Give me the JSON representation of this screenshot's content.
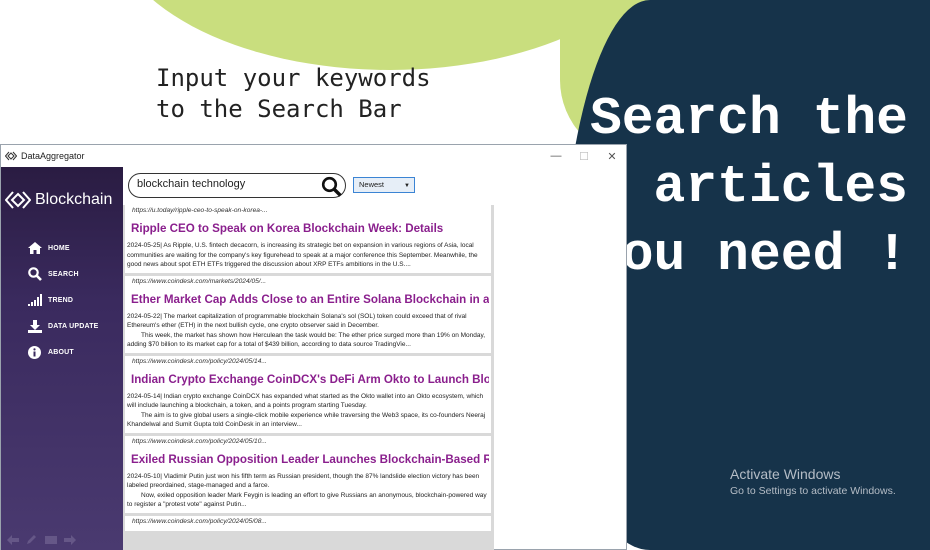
{
  "caption": "Input your keywords\nto the Search Bar",
  "headline": "Search the articles you need !",
  "activation": {
    "line1": "Activate Windows",
    "line2": "Go to Settings to activate Windows."
  },
  "window": {
    "title": "DataAggregator",
    "controls": {
      "minimize": "—",
      "maximize": "☐",
      "close": "✕"
    }
  },
  "sidebar": {
    "brand": "Blockchain",
    "items": [
      {
        "label": "HOME",
        "icon": "home-icon"
      },
      {
        "label": "SEARCH",
        "icon": "search-icon"
      },
      {
        "label": "TREND",
        "icon": "signal-bars-icon"
      },
      {
        "label": "DATA UPDATE",
        "icon": "download-icon"
      },
      {
        "label": "ABOUT",
        "icon": "info-icon"
      }
    ]
  },
  "search": {
    "value": "blockchain technology",
    "sort_selected": "Newest"
  },
  "articles": [
    {
      "url": "https://u.today/ripple-ceo-to-speak-on-korea-...",
      "title": "Ripple CEO to Speak on Korea Blockchain Week: Details",
      "date": "2024-05-25|",
      "p1": "As Ripple, U.S. fintech decacorn, is increasing its strategic bet on expansion in various regions of Asia, local communities are waiting for the company's key figurehead to speak at a major conference this September. Meanwhile, the good news about spot ETH ETFs triggered the discussion about XRP ETFs ambitions in the U.S....",
      "p2": ""
    },
    {
      "url": "https://www.coindesk.com/markets/2024/05/...",
      "title": "Ether Market Cap Adds Close to an Entire Solana Blockchain in a Si...",
      "date": "2024-05-22|",
      "p1": "The market capitalization of programmable blockchain Solana's sol (SOL) token could exceed that of rival Ethereum's ether (ETH) in the next bullish cycle, one crypto observer said in December.",
      "p2": "This week, the market has shown how Herculean the task would be: The ether price surged more than 19% on Monday, adding $70 billion to its market cap for a total of $439 billion, according to data source TradingVie..."
    },
    {
      "url": "https://www.coindesk.com/policy/2024/05/14...",
      "title": "Indian Crypto Exchange CoinDCX's DeFi Arm Okto to Launch Block...",
      "date": "2024-05-14|",
      "p1": "Indian crypto exchange CoinDCX has expanded what started as the Okto wallet into an Okto ecosystem, which will include launching a blockchain, a token, and a points program starting Tuesday.",
      "p2": "The aim is to give global users a single-click mobile experience while traversing the Web3 space, its co-founders Neeraj Khandelwal and Sumit Gupta told CoinDesk in an interview..."
    },
    {
      "url": "https://www.coindesk.com/policy/2024/05/10...",
      "title": "Exiled Russian Opposition Leader Launches Blockchain-Based Refer...",
      "date": "2024-05-10|",
      "p1": "Vladimir Putin just won his fifth term as Russian president, though the 87% landslide election victory has been labeled preordained, stage-managed and a farce.",
      "p2": "Now, exiled opposition leader Mark Feygin is leading an effort to give Russians an anonymous, blockchain-powered way to register a \"protest vote\" against Putin..."
    },
    {
      "url": "https://www.coindesk.com/policy/2024/05/08...",
      "title": "",
      "date": "",
      "p1": "",
      "p2": ""
    }
  ]
}
